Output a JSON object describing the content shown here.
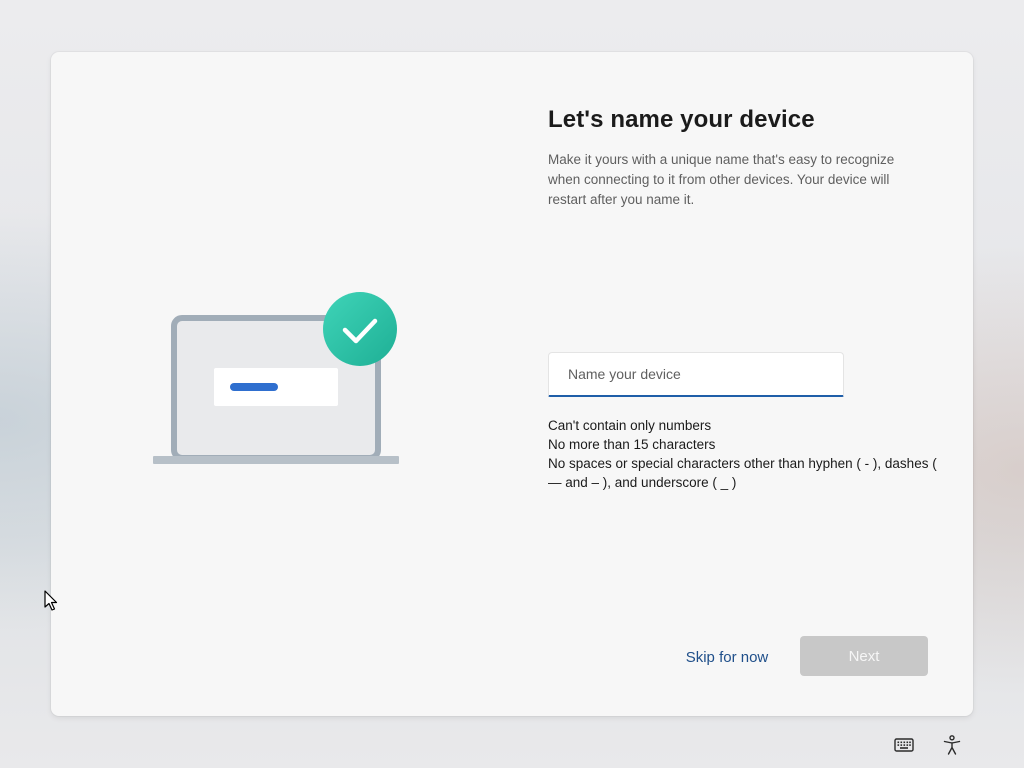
{
  "page": {
    "title": "Let's name your device",
    "description": "Make it yours with a unique name that's easy to recognize when connecting to it from other devices. Your device will restart after you name it."
  },
  "name_input": {
    "placeholder": "Name your device",
    "value": ""
  },
  "rules": [
    "Can't contain only numbers",
    "No more than 15 characters",
    "No spaces or special characters other than hyphen ( - ), dashes ( — and – ), and underscore ( _ )"
  ],
  "actions": {
    "skip_label": "Skip for now",
    "next_label": "Next",
    "next_enabled": false
  },
  "illustration": {
    "subject": "laptop-with-checkmark",
    "badge_icon": "checkmark-icon"
  },
  "taskbar": {
    "icons": [
      "keyboard-icon",
      "accessibility-icon"
    ]
  },
  "colors": {
    "accent": "#1f5ea8",
    "link": "#1f4f8a",
    "check_badge": "#2cc3a6",
    "disabled_button": "#c8c8c8"
  }
}
